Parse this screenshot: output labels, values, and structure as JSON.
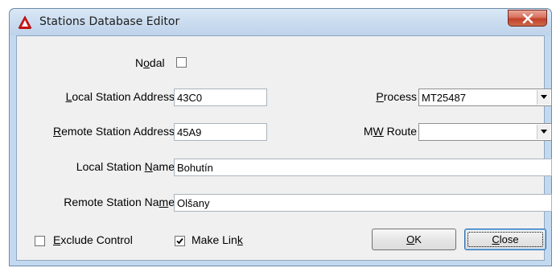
{
  "window": {
    "title": "Stations Database Editor",
    "icon": "warning-triangle-logo-icon",
    "close_icon": "x-close-icon"
  },
  "form": {
    "nodal": {
      "label_pre": "N",
      "label_acc": "o",
      "label_post": "dal",
      "checked": false
    },
    "local_address": {
      "label_pre": "",
      "label_acc": "L",
      "label_post": "ocal Station Address",
      "value": "43C0"
    },
    "remote_address": {
      "label_pre": "",
      "label_acc": "R",
      "label_post": "emote Station Address",
      "value": "45A9"
    },
    "process": {
      "label_pre": "",
      "label_acc": "P",
      "label_post": "rocess",
      "value": "MT25487"
    },
    "mw_route": {
      "label_pre": "M",
      "label_acc": "W",
      "label_post": " Route",
      "value": ""
    },
    "local_name": {
      "label_pre": "Local Station ",
      "label_acc": "N",
      "label_post": "ame",
      "value": "Bohutín"
    },
    "remote_name": {
      "label_pre": "Remote Station Na",
      "label_acc": "m",
      "label_post": "e",
      "value": "Olšany"
    },
    "exclude_control": {
      "label_pre": "",
      "label_acc": "E",
      "label_post": "xclude Control",
      "checked": false
    },
    "make_link": {
      "label_pre": "Make Lin",
      "label_acc": "k",
      "label_post": "",
      "checked": true
    }
  },
  "buttons": {
    "ok": {
      "label_acc": "O",
      "label_post": "K"
    },
    "close": {
      "label_acc": "C",
      "label_post": "lose"
    }
  },
  "colors": {
    "frame": "#c3d9ef",
    "client": "#f0f0f0",
    "close_button": "#c2402a"
  }
}
